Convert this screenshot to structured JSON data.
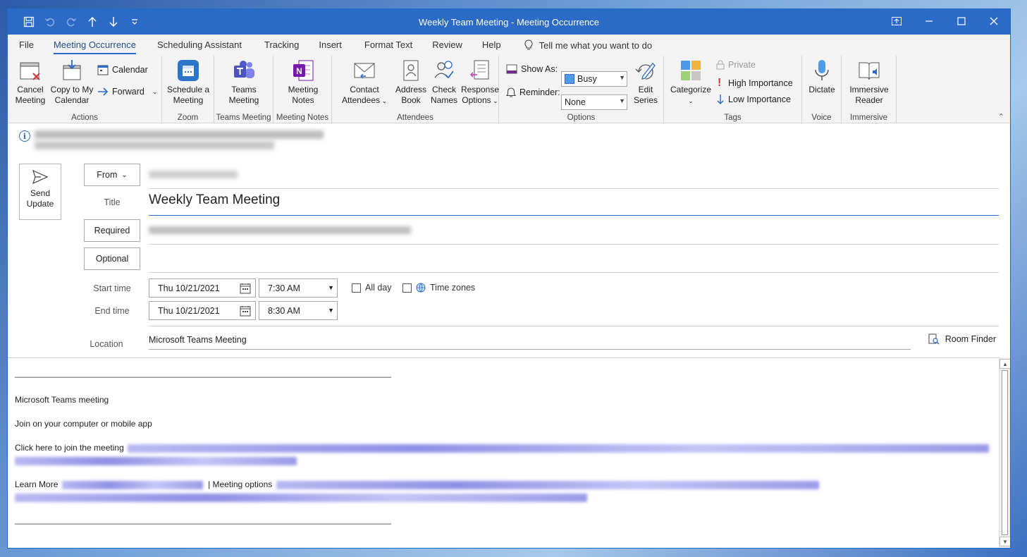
{
  "window": {
    "title": "Weekly Team Meeting  -  Meeting Occurrence"
  },
  "tabs": [
    "File",
    "Meeting Occurrence",
    "Scheduling Assistant",
    "Tracking",
    "Insert",
    "Format Text",
    "Review",
    "Help"
  ],
  "tell_me": "Tell me what you want to do",
  "ribbon": {
    "actions": {
      "label": "Actions",
      "cancel": "Cancel Meeting",
      "copy": "Copy to My Calendar",
      "calendar": "Calendar",
      "forward": "Forward"
    },
    "zoom": {
      "label": "Zoom",
      "schedule": "Schedule a Meeting"
    },
    "teams": {
      "label": "Teams Meeting",
      "button": "Teams Meeting"
    },
    "notes": {
      "label": "Meeting Notes",
      "button": "Meeting Notes"
    },
    "attendees": {
      "label": "Attendees",
      "contact": "Contact Attendees",
      "address": "Address Book",
      "check": "Check Names",
      "response": "Response Options"
    },
    "options": {
      "label": "Options",
      "show_as_label": "Show As:",
      "show_as_value": "Busy",
      "reminder_label": "Reminder:",
      "reminder_value": "None",
      "edit_series": "Edit Series"
    },
    "tags": {
      "label": "Tags",
      "categorize": "Categorize",
      "private": "Private",
      "high": "High Importance",
      "low": "Low Importance"
    },
    "voice": {
      "label": "Voice",
      "dictate": "Dictate"
    },
    "immersive": {
      "label": "Immersive",
      "reader": "Immersive Reader"
    }
  },
  "form": {
    "send_update": "Send Update",
    "from": "From",
    "title_label": "Title",
    "title_value": "Weekly Team Meeting",
    "required": "Required",
    "optional": "Optional",
    "start_label": "Start time",
    "end_label": "End time",
    "start_date": "Thu 10/21/2021",
    "start_time": "7:30 AM",
    "end_date": "Thu 10/21/2021",
    "end_time": "8:30 AM",
    "all_day": "All day",
    "time_zones": "Time zones",
    "location_label": "Location",
    "location_value": "Microsoft Teams Meeting",
    "room_finder": "Room Finder"
  },
  "body": {
    "separator": "________________________________________________________________________________",
    "teams_heading": "Microsoft Teams meeting",
    "join_line": "Join on your computer or mobile app",
    "click_here": "Click here to join the meeting",
    "learn_more": "Learn More",
    "pipe": "|",
    "meeting_options": "Meeting options"
  },
  "colors": {
    "accent": "#2b6ac6",
    "busy": "#4f9be8"
  }
}
